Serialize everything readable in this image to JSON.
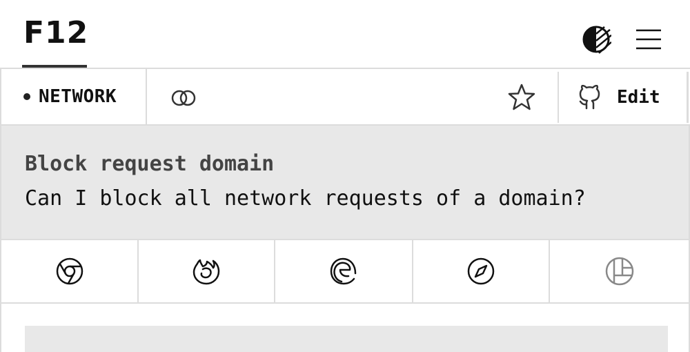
{
  "header": {
    "logo": "F12",
    "icons": {
      "theme": "contrast-theme-icon",
      "menu": "hamburger-menu-icon"
    }
  },
  "topbar": {
    "category": "NETWORK",
    "edit_label": "Edit",
    "icons": {
      "link": "link-icon",
      "star": "star-icon",
      "github": "github-icon"
    }
  },
  "question": {
    "title": "Block request domain",
    "text": "Can I block all network requests of a domain?"
  },
  "browsers": [
    {
      "name": "chrome",
      "icon": "chrome-icon"
    },
    {
      "name": "firefox",
      "icon": "firefox-icon"
    },
    {
      "name": "edge",
      "icon": "edge-icon"
    },
    {
      "name": "safari",
      "icon": "safari-icon"
    },
    {
      "name": "polypane",
      "icon": "polypane-icon"
    }
  ],
  "colors": {
    "text": "#111111",
    "muted": "#444444",
    "panel": "#e8e8e8",
    "border": "#dcdcdc"
  }
}
